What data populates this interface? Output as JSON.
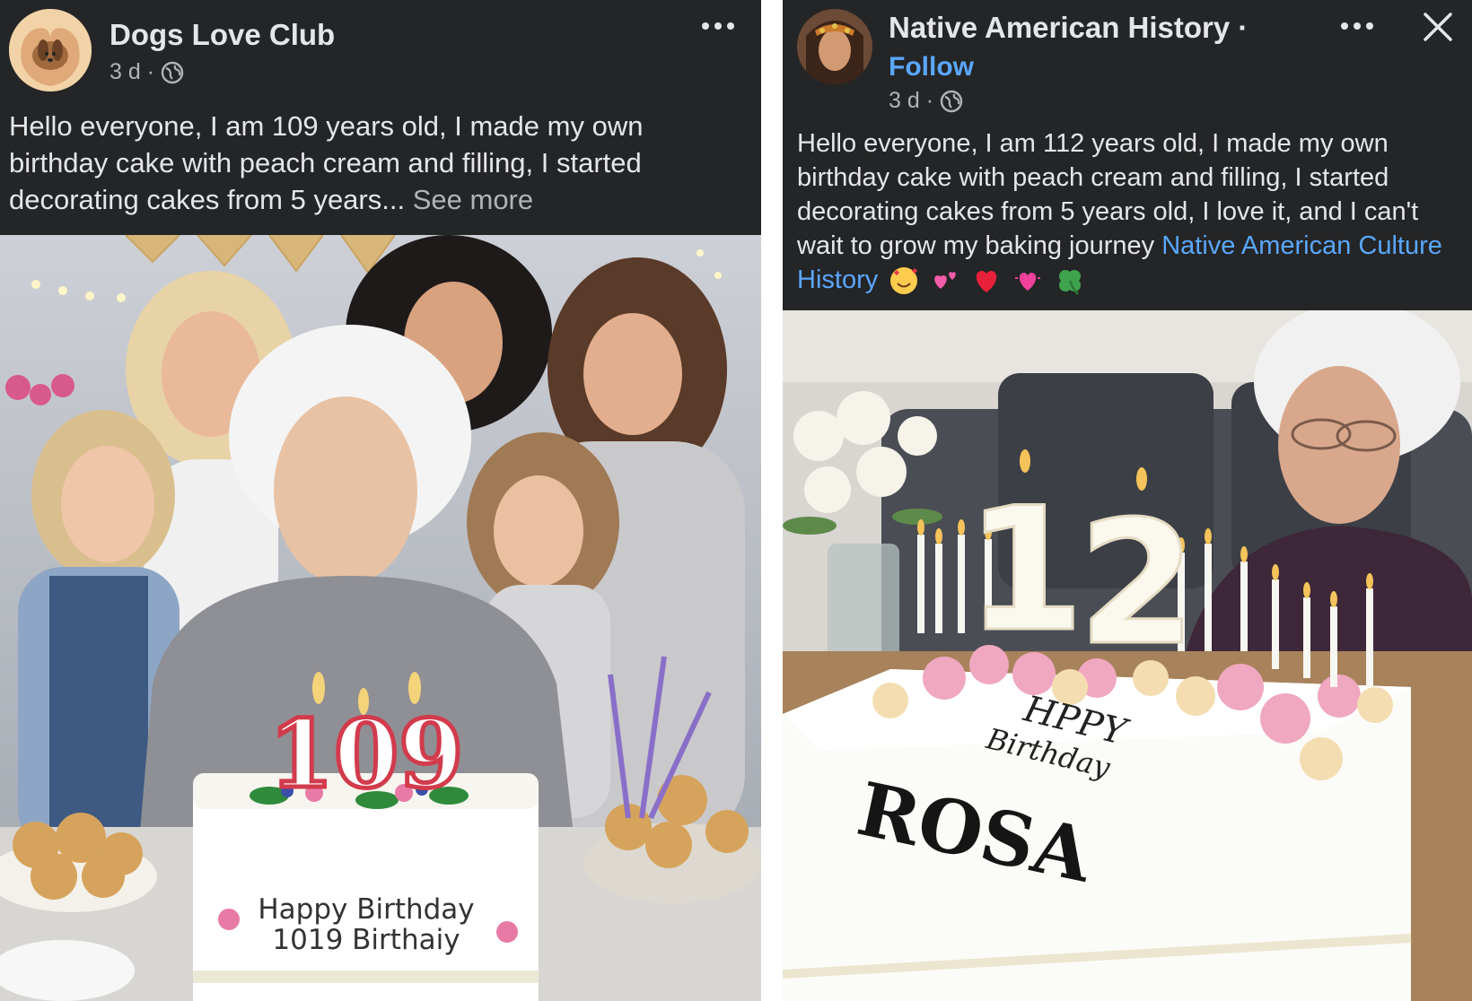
{
  "posts": [
    {
      "author": "Dogs Love Club",
      "timestamp": "3 d",
      "separator": "·",
      "more_icon": "ellipsis-icon",
      "text": "Hello everyone, I am 109 years old, I made my own birthday cake with peach cream and filling, I started decorating cakes from 5 years...",
      "see_more": "See more",
      "cake": {
        "number": "109",
        "line1": "Happy Birthday",
        "line2": "1019 Birthaiy"
      }
    },
    {
      "author": "Native American History",
      "author_suffix": " ·",
      "follow": "Follow",
      "timestamp": "3 d",
      "separator": "·",
      "more_icon": "ellipsis-icon",
      "close_icon": "close-icon",
      "text": "Hello everyone, I am 112 years old, I made my own birthday cake with peach cream and filling, I started decorating cakes from 5 years old, I love it, and I can't wait to grow my baking journey",
      "link_text": "Native American Culture History",
      "emojis": [
        "smiling-face-with-hearts",
        "two-hearts",
        "red-heart",
        "growing-heart",
        "four-leaf-clover"
      ],
      "cake": {
        "number_1": "1",
        "number_2": "2",
        "line1": "HPPY",
        "line2": "Birthday",
        "name": "ROSA"
      }
    }
  ],
  "colors": {
    "post_bg": "#242526",
    "text": "#e4e6eb",
    "secondary_text": "#b0b3b8",
    "link": "#5aa7ff"
  }
}
